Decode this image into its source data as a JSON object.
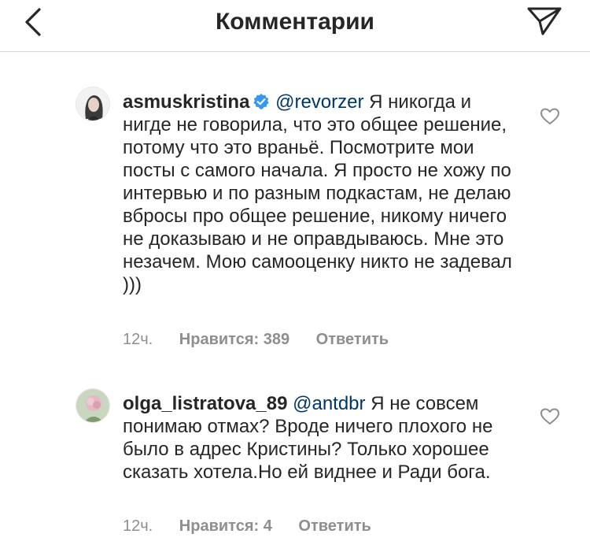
{
  "header": {
    "title": "Комментарии",
    "back_icon": "chevron-left-icon",
    "send_icon": "paper-plane-icon"
  },
  "comments": [
    {
      "username": "asmuskristina",
      "verified": true,
      "mention": "@revorzer",
      "text": "Я никогда и нигде не говорила, что это общее решение, потому что это враньё. Посмотрите мои посты с самого начала. Я просто не хожу по интервью и по разным подкастам, не делаю вбросы про общее решение, никому ничего не доказываю и не оправдываюсь. Мне это незачем. Мою самооценку никто не задевал )))",
      "time": "12ч.",
      "likes": "Нравится: 389",
      "reply": "Ответить"
    },
    {
      "username": "olga_listratova_89",
      "verified": false,
      "mention": "@antdbr",
      "text": "Я не совсем понимаю отмах? Вроде ничего плохого не было в адрес Кристины? Только хорошее сказать хотела.Но ей виднее и Ради бога.",
      "time": "12ч.",
      "likes": "Нравится: 4",
      "reply": "Ответить"
    }
  ],
  "colors": {
    "text": "#262626",
    "secondary": "#8e8e8e",
    "mention": "#00376b",
    "verified": "#3897f0",
    "divider": "#dbdbdb"
  }
}
